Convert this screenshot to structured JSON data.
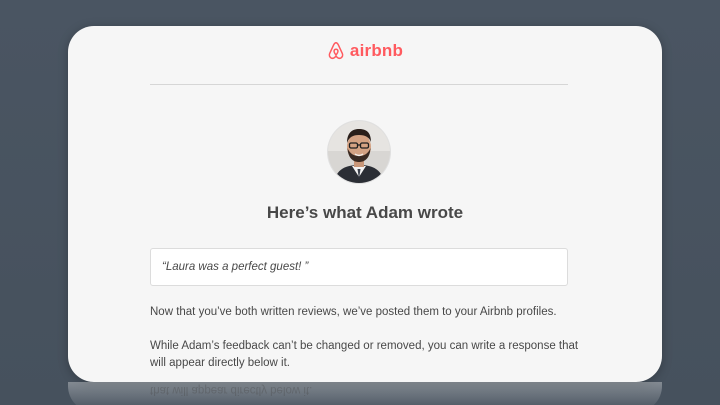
{
  "brand": {
    "name": "airbnb",
    "color": "#ff5a5f",
    "icon": "airbnb-belo-icon"
  },
  "review": {
    "avatar_icon": "reviewer-photo",
    "heading": "Here’s what Adam wrote",
    "quote": "“Laura was a perfect guest! ”"
  },
  "body": {
    "paragraph_1": "Now that you’ve both written reviews, we’ve posted them to your Airbnb profiles.",
    "paragraph_2": "While Adam’s feedback can’t be changed or removed, you can write a response that will appear directly below it.",
    "reflection_text": "that will appear directly below it."
  },
  "colors": {
    "background": "#485360",
    "card": "#f6f6f6",
    "text": "#484848"
  }
}
